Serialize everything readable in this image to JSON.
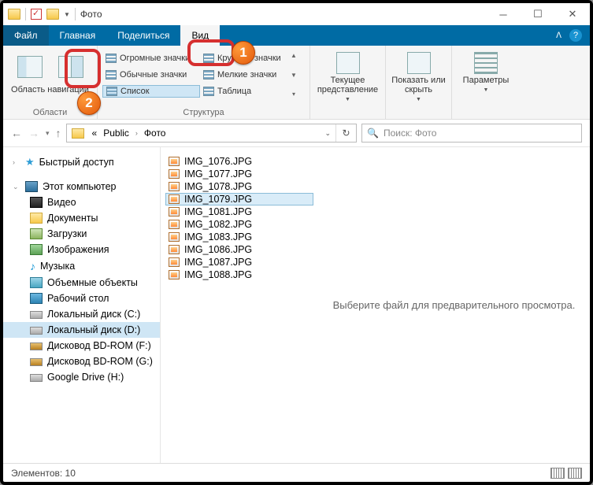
{
  "titlebar": {
    "title": "Фото"
  },
  "menu": {
    "file": "Файл",
    "home": "Главная",
    "share": "Поделиться",
    "view": "Вид"
  },
  "ribbon": {
    "panes_group": "Области",
    "layout_group": "Структура",
    "nav_pane": "Область навигации",
    "layouts": {
      "huge": "Огромные значки",
      "large": "Крупные значки",
      "normal": "Обычные значки",
      "small": "Мелкие значки",
      "list": "Список",
      "table": "Таблица"
    },
    "current_view": "Текущее представление",
    "show_hide": "Показать или скрыть",
    "options": "Параметры"
  },
  "breadcrumbs": {
    "prefix": "«",
    "p1": "Public",
    "p2": "Фото"
  },
  "search": {
    "placeholder": "Поиск: Фото"
  },
  "tree": {
    "quick": "Быстрый доступ",
    "thispc": "Этот компьютер",
    "video": "Видео",
    "docs": "Документы",
    "downloads": "Загрузки",
    "pictures": "Изображения",
    "music": "Музыка",
    "objects3d": "Объемные объекты",
    "desktop": "Рабочий стол",
    "drive_c": "Локальный диск (C:)",
    "drive_d": "Локальный диск (D:)",
    "bd_f": "Дисковод BD-ROM (F:)",
    "bd_g": "Дисковод BD-ROM (G:)",
    "gdrive": "Google Drive (H:)"
  },
  "files": [
    "IMG_1076.JPG",
    "IMG_1077.JPG",
    "IMG_1078.JPG",
    "IMG_1079.JPG",
    "IMG_1081.JPG",
    "IMG_1082.JPG",
    "IMG_1083.JPG",
    "IMG_1086.JPG",
    "IMG_1087.JPG",
    "IMG_1088.JPG"
  ],
  "selected_file_index": 3,
  "preview": {
    "empty": "Выберите файл для предварительного просмотра."
  },
  "status": {
    "count_label": "Элементов: 10"
  },
  "callouts": {
    "one": "1",
    "two": "2"
  }
}
